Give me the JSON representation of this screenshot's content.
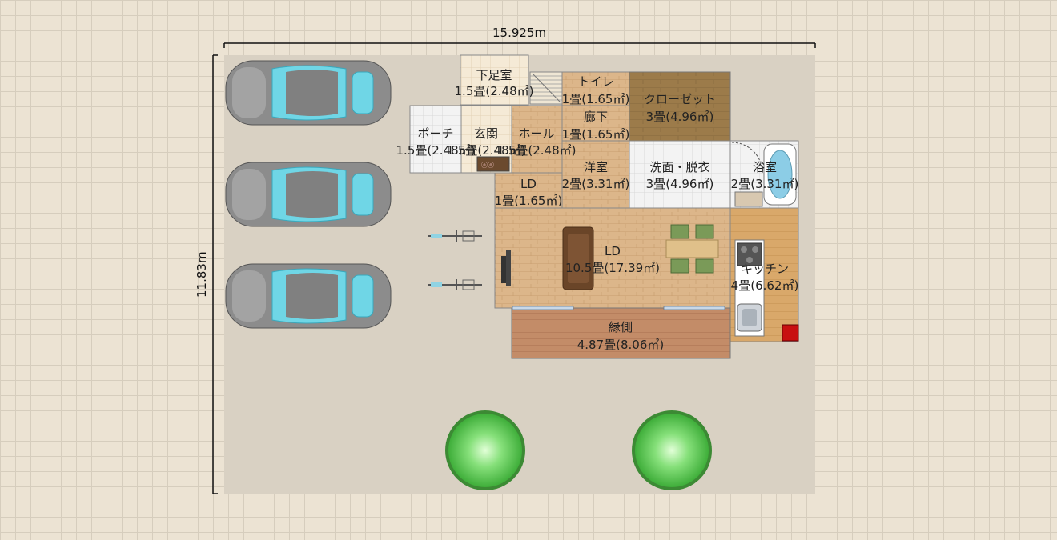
{
  "dimensions": {
    "width_label": "15.925m",
    "height_label": "11.83m"
  },
  "rooms": {
    "shitasoku": {
      "name": "下足室",
      "area": "1.5畳(2.48㎡)"
    },
    "toilet": {
      "name": "トイレ",
      "area": "1畳(1.65㎡)"
    },
    "closet": {
      "name": "クローゼット",
      "area": "3畳(4.96㎡)"
    },
    "hallway": {
      "name": "廊下",
      "area": "1畳(1.65㎡)"
    },
    "porch": {
      "name": "ポーチ",
      "area": "1.5畳(2.48㎡)"
    },
    "genkan": {
      "name": "玄関",
      "area": "1.5畳(2.48㎡)"
    },
    "hall": {
      "name": "ホール",
      "area": "1.5畳(2.48㎡)"
    },
    "youshitsu": {
      "name": "洋室",
      "area": "2畳(3.31㎡)"
    },
    "senmen": {
      "name": "洗面・脱衣",
      "area": "3畳(4.96㎡)"
    },
    "bath": {
      "name": "浴室",
      "area": "2畳(3.31㎡)"
    },
    "ld_small": {
      "name": "LD",
      "area": "1畳(1.65㎡)"
    },
    "ld_main": {
      "name": "LD",
      "area": "10.5畳(17.39㎡)"
    },
    "kitchen": {
      "name": "キッチン",
      "area": "4畳(6.62㎡)"
    },
    "engawa": {
      "name": "縁側",
      "area": "4.87畳(8.06㎡)"
    }
  },
  "icons": {
    "cars": "car-icon",
    "bicycles": "bicycle-icon",
    "trees": "tree-icon",
    "sofa": "sofa-icon",
    "tv": "tv-icon",
    "dining": "dining-table-icon",
    "stove": "stove-icon",
    "sink": "sink-icon",
    "bathtub": "bathtub-icon",
    "stairs": "stairs-icon",
    "fridge": "refrigerator-icon"
  },
  "colors": {
    "background": "#ece3d3",
    "lot": "#d9d1c3",
    "wood_floor": "#dbb68a",
    "closet_floor": "#9c7b4a",
    "tile_floor": "#f2f2f2",
    "deck": "#c08a66",
    "car_body": "#8c8c8c",
    "car_glass": "#6fd6e6",
    "tree": "#5fcf5f"
  }
}
